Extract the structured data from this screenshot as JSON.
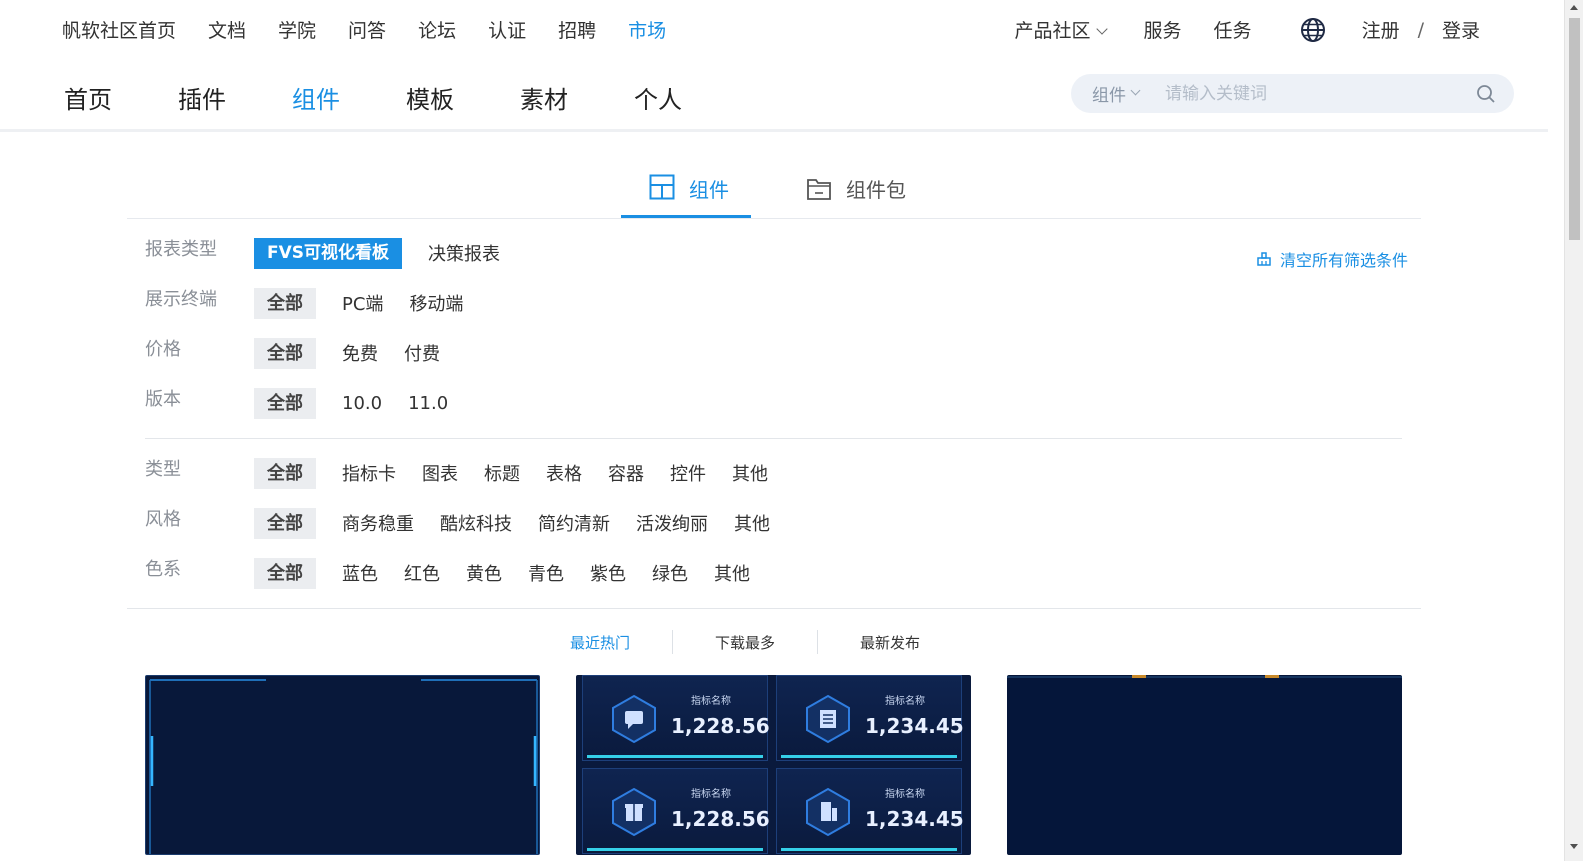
{
  "topnav": {
    "left": [
      "帆软社区首页",
      "文档",
      "学院",
      "问答",
      "论坛",
      "认证",
      "招聘",
      "市场"
    ],
    "active": "市场",
    "right": {
      "community": "产品社区",
      "services": "服务",
      "tasks": "任务",
      "register": "注册",
      "slash": "/",
      "login": "登录"
    }
  },
  "subnav": {
    "items": [
      "首页",
      "插件",
      "组件",
      "模板",
      "素材",
      "个人"
    ],
    "active": "组件"
  },
  "search": {
    "category": "组件",
    "placeholder": "请输入关键词"
  },
  "tabs": {
    "components": "组件",
    "packages": "组件包"
  },
  "filters": {
    "report_type": {
      "label": "报表类型",
      "options": [
        "FVS可视化看板",
        "决策报表"
      ]
    },
    "terminal": {
      "label": "展示终端",
      "options": [
        "全部",
        "PC端",
        "移动端"
      ]
    },
    "price": {
      "label": "价格",
      "options": [
        "全部",
        "免费",
        "付费"
      ]
    },
    "version": {
      "label": "版本",
      "options": [
        "全部",
        "10.0",
        "11.0"
      ]
    },
    "type": {
      "label": "类型",
      "options": [
        "全部",
        "指标卡",
        "图表",
        "标题",
        "表格",
        "容器",
        "控件",
        "其他"
      ]
    },
    "style": {
      "label": "风格",
      "options": [
        "全部",
        "商务稳重",
        "酷炫科技",
        "简约清新",
        "活泼绚丽",
        "其他"
      ]
    },
    "color": {
      "label": "色系",
      "options": [
        "全部",
        "蓝色",
        "红色",
        "黄色",
        "青色",
        "紫色",
        "绿色",
        "其他"
      ]
    },
    "clear_all": "清空所有筛选条件"
  },
  "sort": {
    "hot": "最近热门",
    "downloads": "下载最多",
    "newest": "最新发布"
  },
  "kpi_cards": [
    {
      "label": "指标名称",
      "value": "1,228.56"
    },
    {
      "label": "指标名称",
      "value": "1,234.45"
    },
    {
      "label": "指标名称",
      "value": "1,228.56"
    },
    {
      "label": "指标名称",
      "value": "1,234.45"
    }
  ],
  "colors": {
    "accent": "#1a8fe3",
    "card_bg": "#08183a",
    "kpi_bar": "#35d0e8"
  }
}
